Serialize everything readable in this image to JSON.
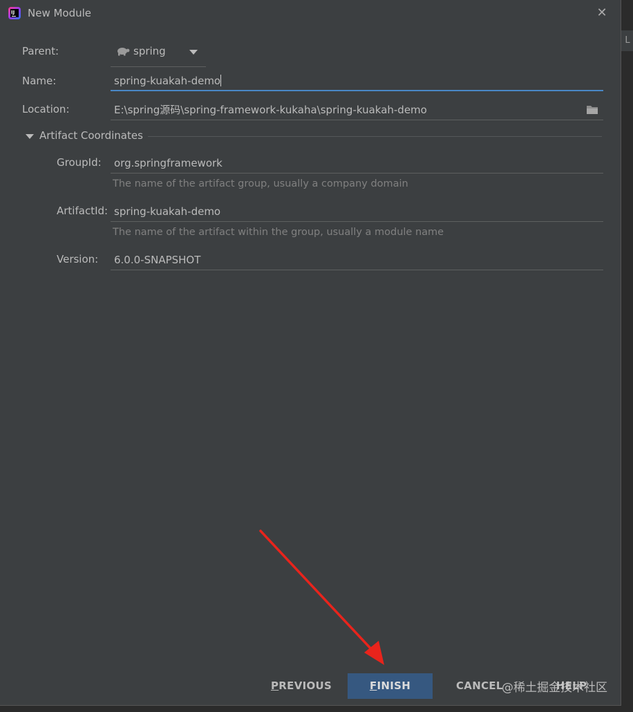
{
  "dialog": {
    "title": "New Module",
    "close_glyph": "✕"
  },
  "background": {
    "tab_letter": "L"
  },
  "form": {
    "parent": {
      "label": "Parent:",
      "value": "spring",
      "icon": "spring-turtle-icon"
    },
    "name": {
      "label": "Name:",
      "value": "spring-kuakah-demo"
    },
    "location": {
      "label": "Location:",
      "value": "E:\\spring源码\\spring-framework-kukaha\\spring-kuakah-demo",
      "icon": "folder-icon"
    }
  },
  "artifact_coordinates": {
    "title": "Artifact Coordinates",
    "group_id": {
      "label": "GroupId:",
      "value": "org.springframework",
      "hint": "The name of the artifact group, usually a company domain"
    },
    "artifact_id": {
      "label": "ArtifactId:",
      "value": "spring-kuakah-demo",
      "hint": "The name of the artifact within the group, usually a module name"
    },
    "version": {
      "label": "Version:",
      "value": "6.0.0-SNAPSHOT"
    }
  },
  "buttons": {
    "previous_mnemonic": "P",
    "previous_rest": "REVIOUS",
    "finish_mnemonic": "F",
    "finish_rest": "INISH",
    "cancel": "CANCEL",
    "help": "HELP"
  },
  "watermark": "@稀土掘金技术社区",
  "colors": {
    "dialog_bg": "#3c3f41",
    "text": "#bbbbbb",
    "hint": "#808080",
    "accent": "#4a88c7",
    "primary_button": "#365880",
    "annotation_arrow": "#e8241c"
  }
}
